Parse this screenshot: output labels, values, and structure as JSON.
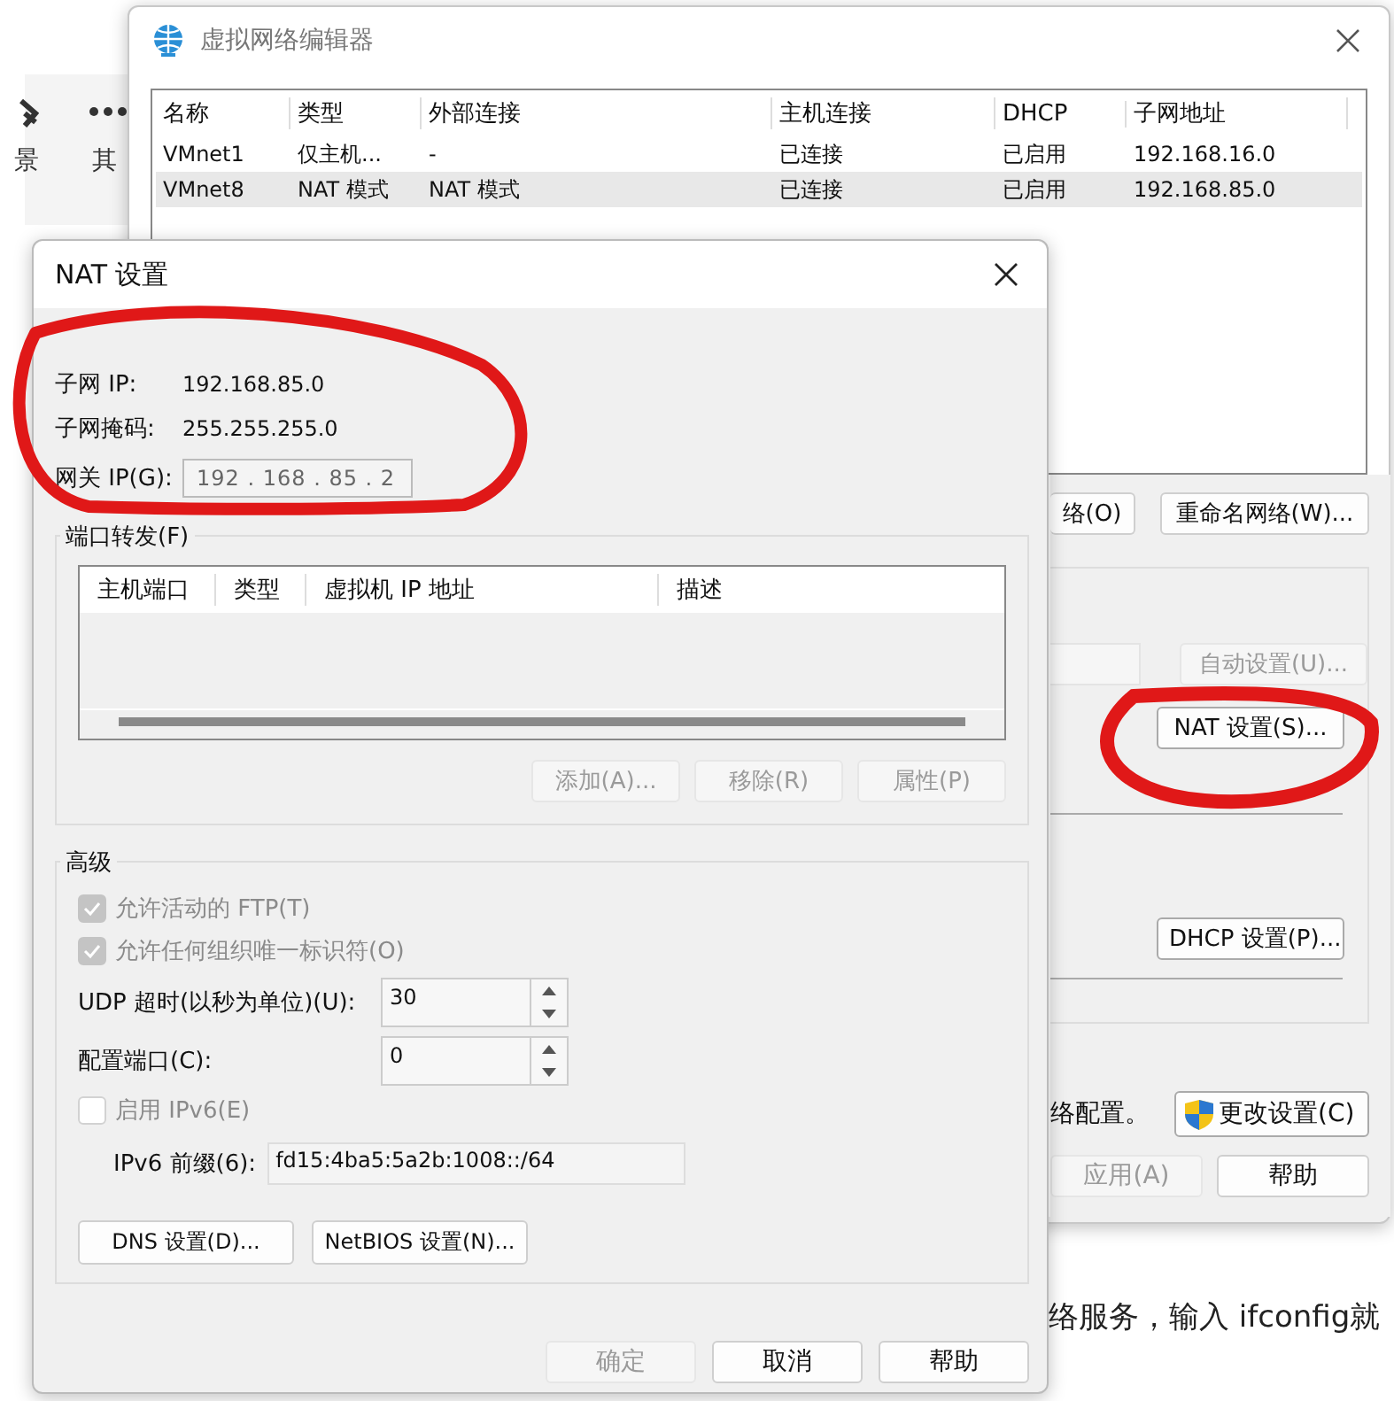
{
  "background_page": {
    "toolbar_labels": [
      "景",
      "其"
    ],
    "text_fragment": "络服务，输入 ifconfig就"
  },
  "network_editor": {
    "title": "虚拟网络编辑器",
    "table": {
      "columns": [
        "名称",
        "类型",
        "外部连接",
        "主机连接",
        "DHCP",
        "子网地址"
      ],
      "rows": [
        {
          "cells": [
            "VMnet1",
            "仅主机...",
            "-",
            "已连接",
            "已启用",
            "192.168.16.0"
          ],
          "selected": false
        },
        {
          "cells": [
            "VMnet8",
            "NAT 模式",
            "NAT 模式",
            "已连接",
            "已启用",
            "192.168.85.0"
          ],
          "selected": true
        }
      ]
    },
    "network_buttons": [
      {
        "label": "络(O)",
        "disabled": false
      },
      {
        "label": "重命名网络(W)...",
        "disabled": false
      }
    ],
    "auto_button": {
      "label": "自动设置(U)...",
      "disabled": true
    },
    "nat_button": {
      "label": "NAT 设置(S)...",
      "disabled": false
    },
    "dhcp_button": {
      "label": "DHCP 设置(P)...",
      "disabled": false
    },
    "admin_note": "络配置。",
    "change_settings_button": "更改设置(C)",
    "footer_buttons": [
      {
        "label": "应用(A)",
        "disabled": true
      },
      {
        "label": "帮助",
        "disabled": false
      }
    ]
  },
  "nat_dialog": {
    "title": "NAT 设置",
    "fields": [
      {
        "label": "子网 IP:",
        "value": "192.168.85.0"
      },
      {
        "label": "子网掩码:",
        "value": "255.255.255.0"
      }
    ],
    "gateway": {
      "label": "网关 IP(G):",
      "value": "192 . 168 . 85 . 2"
    },
    "port_forwarding": {
      "title": "端口转发(F)",
      "columns": [
        "主机端口",
        "类型",
        "虚拟机 IP 地址",
        "描述"
      ],
      "buttons": [
        {
          "label": "添加(A)...",
          "disabled": true
        },
        {
          "label": "移除(R)",
          "disabled": true
        },
        {
          "label": "属性(P)",
          "disabled": true
        }
      ]
    },
    "advanced": {
      "title": "高级",
      "checkboxes": [
        {
          "label": "允许活动的 FTP(T)",
          "checked": true,
          "disabled": true
        },
        {
          "label": "允许任何组织唯一标识符(O)",
          "checked": true,
          "disabled": true
        }
      ],
      "spinners": [
        {
          "label": "UDP 超时(以秒为单位)(U):",
          "value": "30"
        },
        {
          "label": "配置端口(C):",
          "value": "0"
        }
      ],
      "ipv6_checkbox": {
        "label": "启用 IPv6(E)",
        "checked": false,
        "disabled": true
      },
      "ipv6_prefix": {
        "label": "IPv6 前缀(6):",
        "value": "fd15:4ba5:5a2b:1008::/64"
      },
      "buttons": [
        "DNS 设置(D)...",
        "NetBIOS 设置(N)..."
      ]
    },
    "footer_buttons": [
      {
        "label": "确定",
        "disabled": true
      },
      {
        "label": "取消",
        "disabled": false
      },
      {
        "label": "帮助",
        "disabled": false
      }
    ]
  }
}
